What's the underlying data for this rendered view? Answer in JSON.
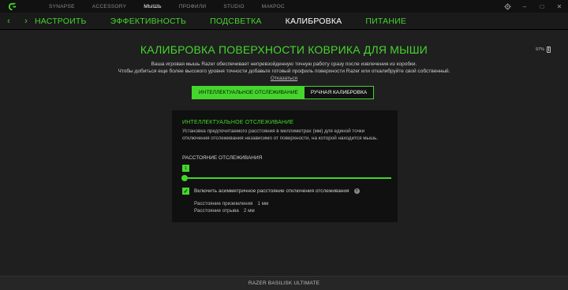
{
  "topnav": {
    "items": [
      "SYNAPSE",
      "ACCESSORY",
      "МЫШЬ",
      "ПРОФИЛИ",
      "STUDIO",
      "МАКРОС"
    ],
    "active_index": 2
  },
  "window_controls": {
    "settings_icon": "gear-icon",
    "minimize": "–",
    "maximize": "□",
    "close": "✕"
  },
  "tabs": {
    "items": [
      "НАСТРОИТЬ",
      "ЭФФЕКТИВНОСТЬ",
      "ПОДСВЕТКА",
      "КАЛИБРОВКА",
      "ПИТАНИЕ"
    ],
    "active_index": 3,
    "back": "‹",
    "forward": "›"
  },
  "main": {
    "heading": "КАЛИБРОВКА ПОВЕРХНОСТИ КОВРИКА ДЛЯ МЫШИ",
    "battery": "97%",
    "desc_line1": "Ваша игровая мышь Razer обеспечивает непревзойденную точную работу сразу после извлечения из коробки.",
    "desc_line2": "Чтобы добиться еще более высокого уровня точности добавьте готовый профиль поверхности Razer или откалибруйте свой собственный.",
    "cancel_link": "Отказаться",
    "toggle_smart": "ИНТЕЛЛЕКТУАЛЬНОЕ ОТСЛЕЖИВАНИЕ",
    "toggle_manual": "РУЧНАЯ КАЛИБРОВКА"
  },
  "card": {
    "title": "ИНТЕЛЛЕКТУАЛЬНОЕ ОТСЛЕЖИВАНИЕ",
    "description": "Установка предпочитаемого расстояния в миллиметрах (мм) для единой точки отключения отслеживания независимо от поверхности, на которой находится мышь.",
    "slider_label": "РАССТОЯНИЕ ОТСЛЕЖИВАНИЯ",
    "slider_value": "1",
    "checkbox_label": "Включить асимметричное расстояние отключения отслеживания",
    "checkbox_checked": true,
    "landing_label": "Расстояние приземления",
    "landing_value": "1 мм",
    "liftoff_label": "Расстояние отрыва",
    "liftoff_value": "2 мм"
  },
  "footer": {
    "device": "RAZER BASILISK ULTIMATE"
  },
  "colors": {
    "accent": "#44d62c",
    "background": "#1f1f1f",
    "card": "#101010"
  }
}
